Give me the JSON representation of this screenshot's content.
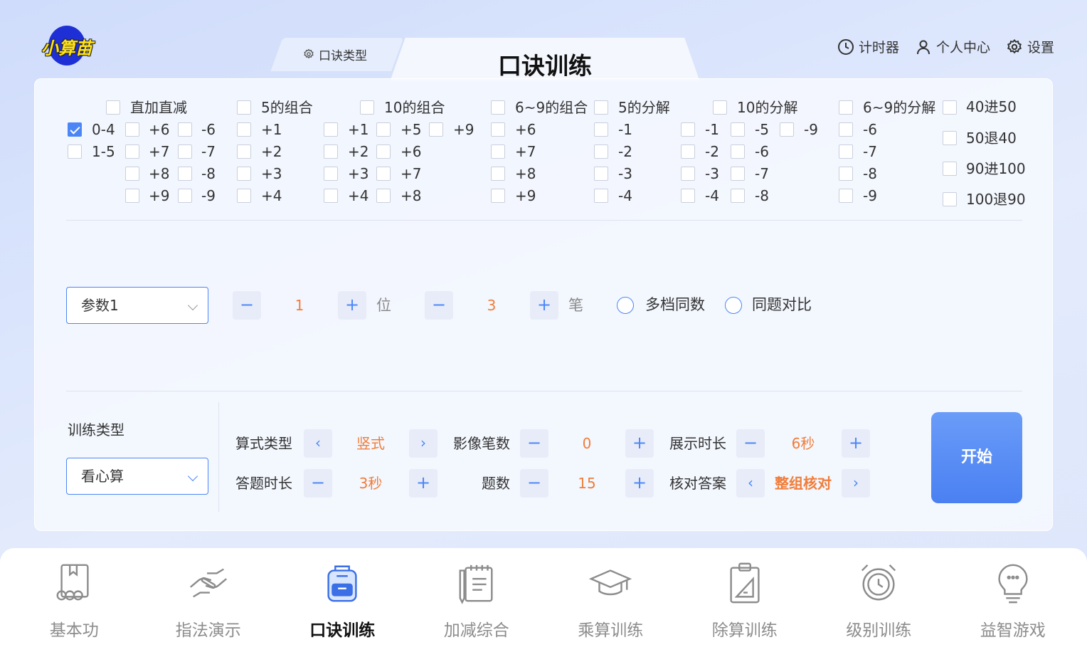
{
  "app": {
    "logo_text": "小算苗"
  },
  "tabs": {
    "back_label": "口诀类型",
    "active_label": "口诀训练"
  },
  "top_actions": [
    {
      "label": "计时器",
      "icon": "clock-icon"
    },
    {
      "label": "个人中心",
      "icon": "user-icon"
    },
    {
      "label": "设置",
      "icon": "gear-icon"
    }
  ],
  "groups": {
    "zhijia": {
      "title": "直加直减",
      "row_0_4": "0-4",
      "row_1_5": "1-5",
      "row_0_4_checked": true,
      "col1": [
        "+6",
        "+7",
        "+8",
        "+9"
      ],
      "col2": [
        "-6",
        "-7",
        "-8",
        "-9"
      ]
    },
    "wu_zuhe": {
      "title": "5的组合",
      "items": [
        "+1",
        "+2",
        "+3",
        "+4"
      ]
    },
    "shi_zuhe": {
      "title": "10的组合",
      "col1": [
        "+1",
        "+2",
        "+3",
        "+4"
      ],
      "col2": [
        "+5",
        "+6",
        "+7",
        "+8"
      ],
      "col3": [
        "+9"
      ]
    },
    "liujiu_zuhe": {
      "title": "6~9的组合",
      "items": [
        "+6",
        "+7",
        "+8",
        "+9"
      ]
    },
    "wu_fenjie": {
      "title": "5的分解",
      "items": [
        "-1",
        "-2",
        "-3",
        "-4"
      ]
    },
    "shi_fenjie": {
      "title": "10的分解",
      "col1": [
        "-1",
        "-2",
        "-3",
        "-4"
      ],
      "col2": [
        "-5",
        "-6",
        "-7",
        "-8"
      ],
      "col3": [
        "-9"
      ]
    },
    "liujiu_fenjie": {
      "title": "6~9的分解",
      "items": [
        "-6",
        "-7",
        "-8",
        "-9"
      ]
    },
    "jintui": {
      "items": [
        "40进50",
        "50退40",
        "90进100",
        "100退90"
      ]
    }
  },
  "params": {
    "select_value": "参数1",
    "digits": {
      "value": "1",
      "unit": "位"
    },
    "strokes": {
      "value": "3",
      "unit": "笔"
    },
    "radio1": "多档同数",
    "radio2": "同题对比"
  },
  "training": {
    "type_label": "训练类型",
    "type_value": "看心算",
    "formula_type": {
      "label": "算式类型",
      "value": "竖式"
    },
    "image_strokes": {
      "label": "影像笔数",
      "value": "0"
    },
    "display_time": {
      "label": "展示时长",
      "value": "6秒"
    },
    "answer_time": {
      "label": "答题时长",
      "value": "3秒"
    },
    "question_count": {
      "label": "题数",
      "value": "15"
    },
    "check_answer": {
      "label": "核对答案",
      "value": "整组核对"
    },
    "start_label": "开始"
  },
  "bottom_nav": [
    {
      "label": "基本功",
      "icon": "book-abacus-icon",
      "active": false
    },
    {
      "label": "指法演示",
      "icon": "hands-icon",
      "active": false
    },
    {
      "label": "口诀训练",
      "icon": "backpack-icon",
      "active": true
    },
    {
      "label": "加减综合",
      "icon": "notebook-icon",
      "active": false
    },
    {
      "label": "乘算训练",
      "icon": "graduation-cap-icon",
      "active": false
    },
    {
      "label": "除算训练",
      "icon": "clipboard-ruler-icon",
      "active": false
    },
    {
      "label": "级别训练",
      "icon": "alarm-clock-icon",
      "active": false
    },
    {
      "label": "益智游戏",
      "icon": "lightbulb-icon",
      "active": false
    }
  ],
  "colors": {
    "accent": "#4c86f6",
    "value": "#f07d3a"
  }
}
